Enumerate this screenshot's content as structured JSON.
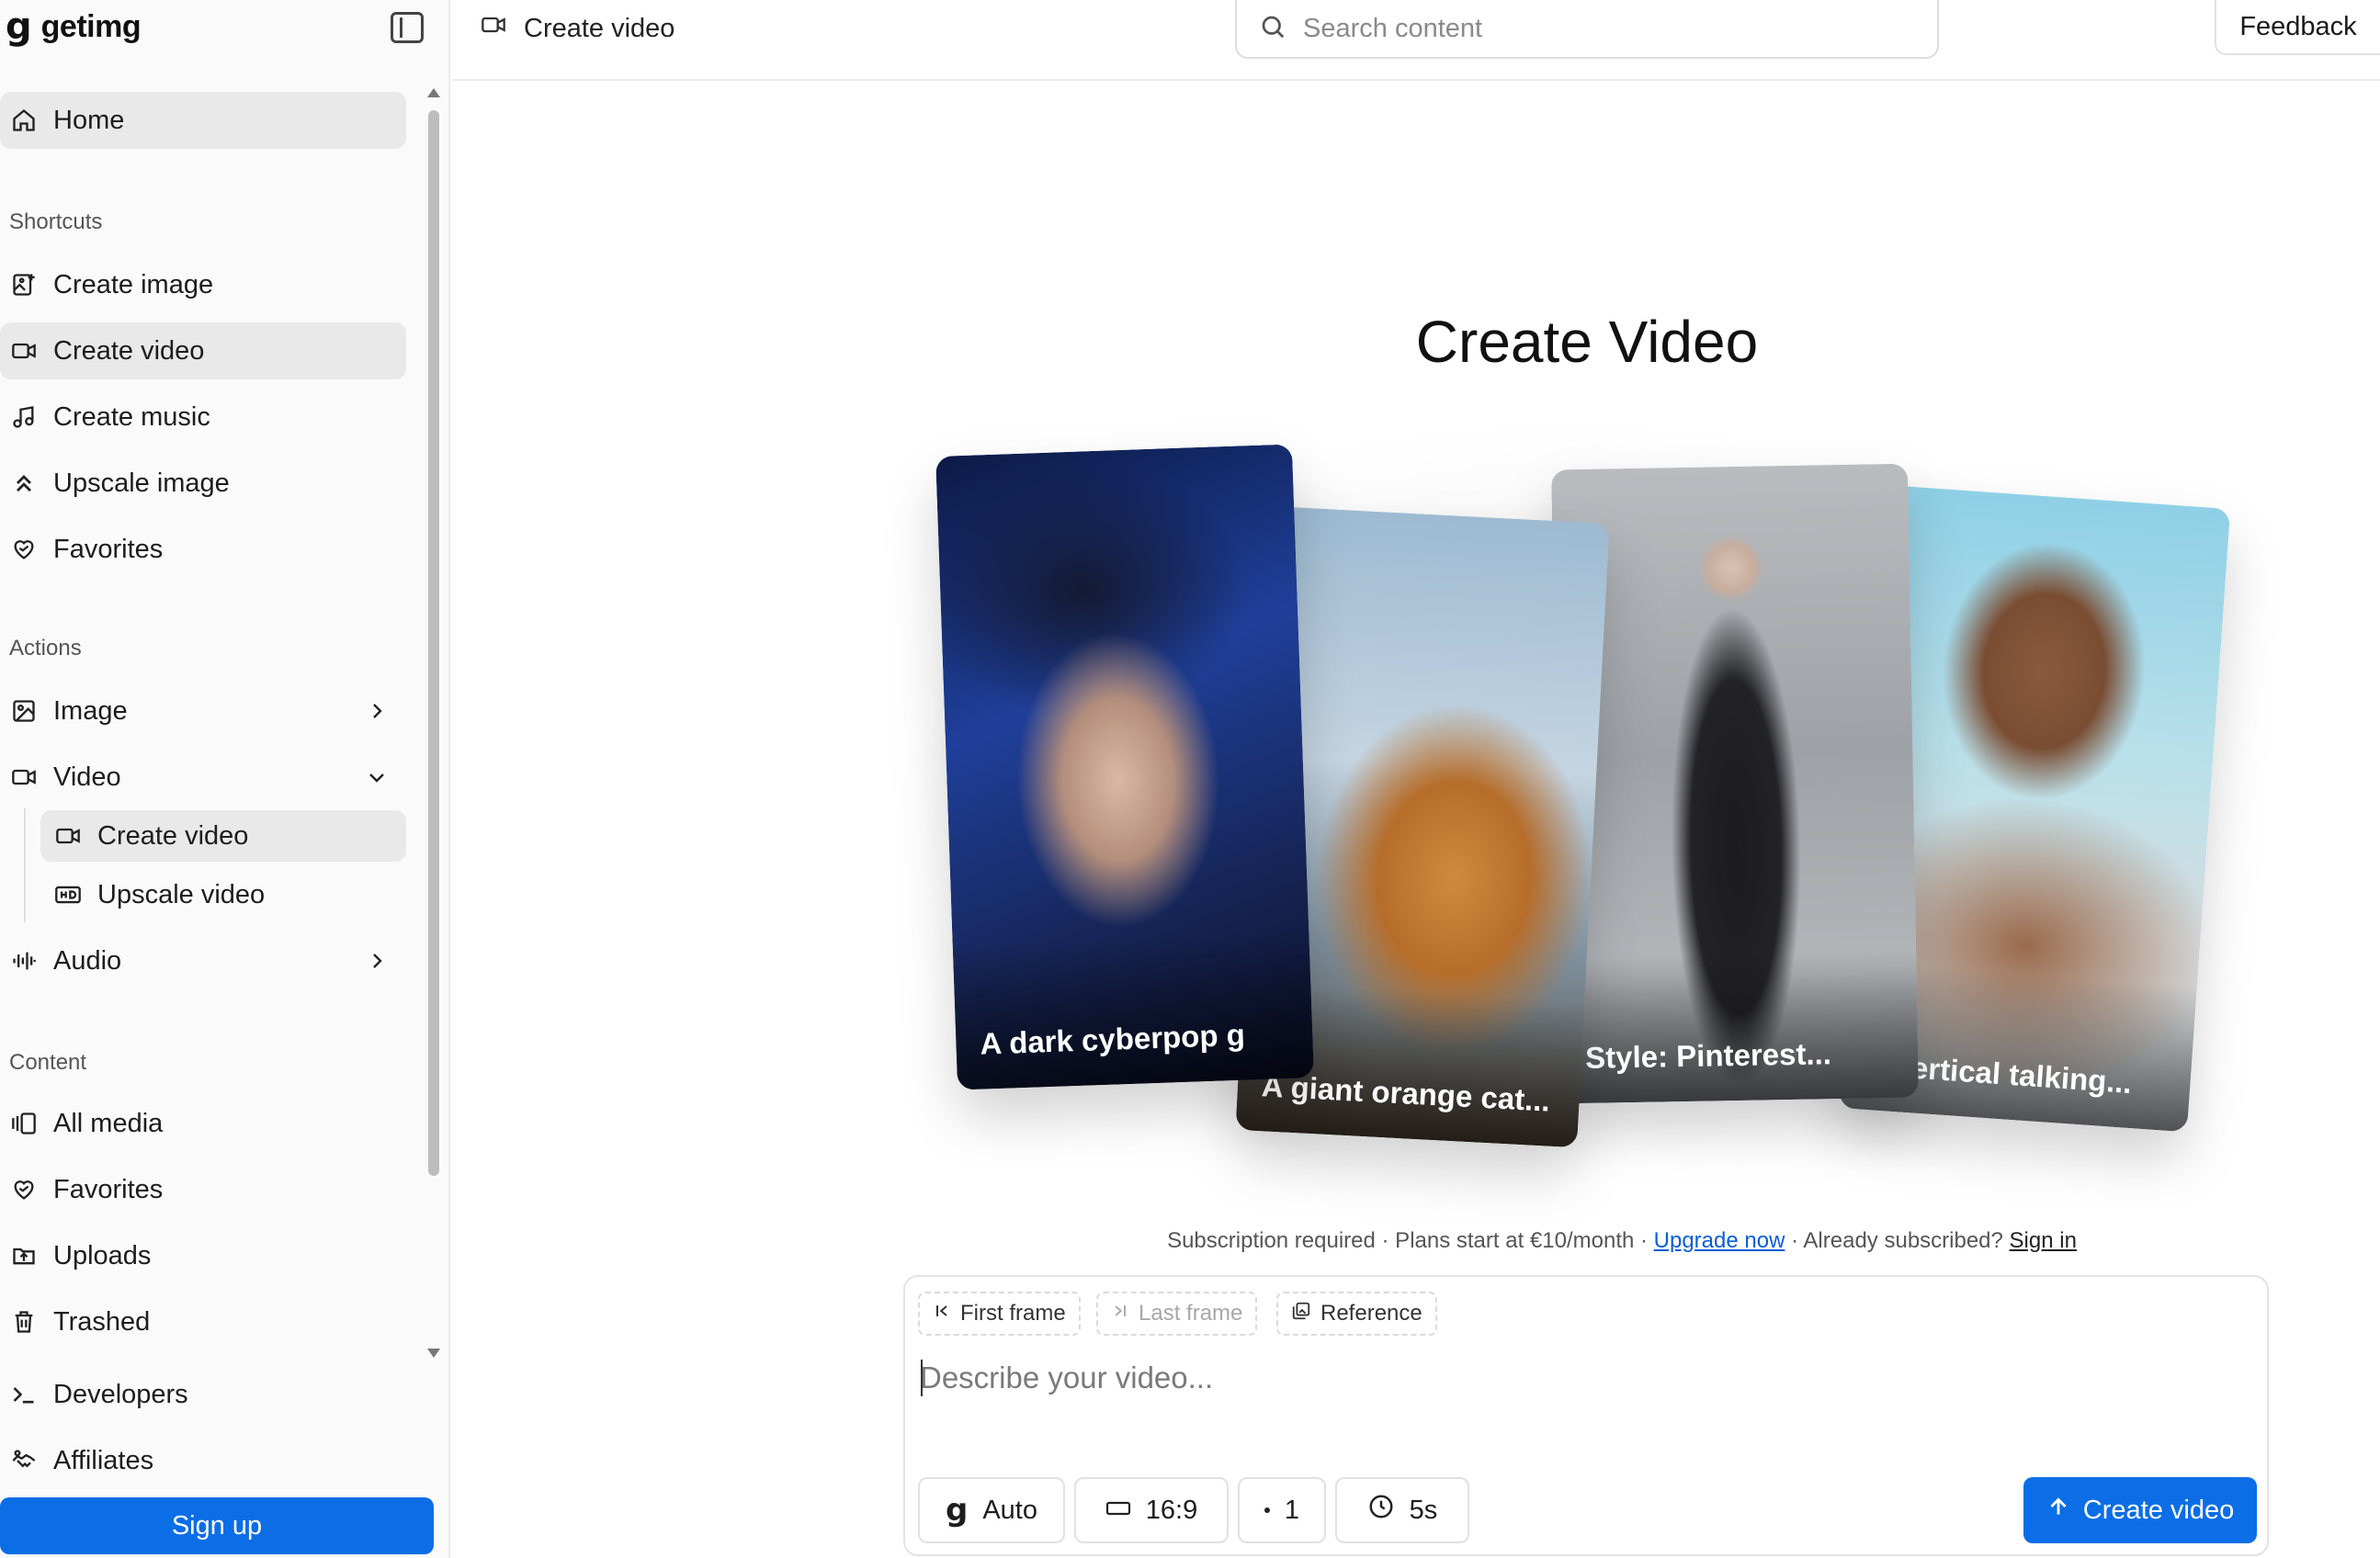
{
  "brand": {
    "name": "getimg"
  },
  "sidebar": {
    "home": "Home",
    "sections": {
      "shortcuts": "Shortcuts",
      "actions": "Actions",
      "content": "Content"
    },
    "shortcuts": [
      {
        "label": "Create image",
        "icon": "image-plus-icon"
      },
      {
        "label": "Create video",
        "icon": "video-camera-icon"
      },
      {
        "label": "Create music",
        "icon": "music-note-icon"
      },
      {
        "label": "Upscale image",
        "icon": "chevrons-up-icon"
      },
      {
        "label": "Favorites",
        "icon": "heart-icon"
      }
    ],
    "actions": [
      {
        "label": "Image",
        "icon": "image-icon"
      },
      {
        "label": "Video",
        "icon": "video-camera-icon"
      },
      {
        "label": "Audio",
        "icon": "audio-wave-icon"
      }
    ],
    "video_sub": [
      {
        "label": "Create video",
        "icon": "video-camera-icon"
      },
      {
        "label": "Upscale video",
        "icon": "hd-icon"
      }
    ],
    "content": [
      {
        "label": "All media",
        "icon": "media-library-icon"
      },
      {
        "label": "Favorites",
        "icon": "heart-icon"
      },
      {
        "label": "Uploads",
        "icon": "upload-icon"
      },
      {
        "label": "Trashed",
        "icon": "trash-icon"
      }
    ],
    "footer": [
      {
        "label": "Developers",
        "icon": "terminal-icon"
      },
      {
        "label": "Affiliates",
        "icon": "handshake-icon"
      }
    ],
    "signup": "Sign up"
  },
  "header": {
    "breadcrumb": "Create video",
    "search_placeholder": "Search content",
    "feedback": "Feedback"
  },
  "main": {
    "title": "Create Video",
    "cards": [
      {
        "caption": "A dark cyberpop g"
      },
      {
        "caption": "A giant orange cat..."
      },
      {
        "caption": "Style: Pinterest..."
      },
      {
        "caption": "A vertical talking..."
      }
    ],
    "subscription": {
      "text1": "Subscription required · Plans start at €10/month · ",
      "upgrade": "Upgrade now",
      "text2": " · Already subscribed? ",
      "signin": "Sign in"
    },
    "composer": {
      "chips": {
        "first_frame": "First frame",
        "last_frame": "Last frame",
        "reference": "Reference"
      },
      "placeholder": "Describe your video...",
      "options": {
        "model": "Auto",
        "aspect": "16:9",
        "count": "1",
        "duration": "5s"
      },
      "submit": "Create video"
    }
  },
  "colors": {
    "accent": "#0b6ee6",
    "active_bg": "#e9e9ea",
    "link": "#0b5ed7"
  }
}
